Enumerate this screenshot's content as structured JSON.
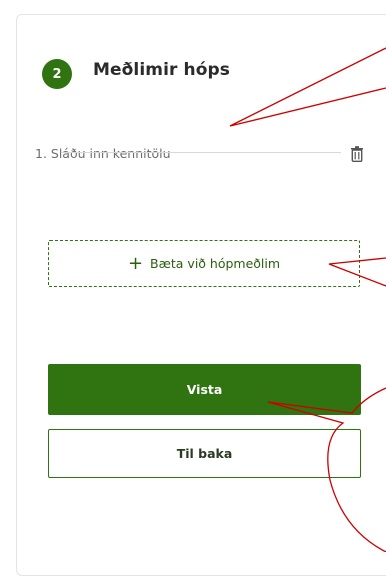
{
  "colors": {
    "accent": "#2f7410",
    "annotation": "#cc0000"
  },
  "section": {
    "step_number": "2",
    "title": "Meðlimir hóps"
  },
  "members": [
    {
      "placeholder": "1. Sláðu inn kennitölu",
      "value": ""
    }
  ],
  "icons": {
    "delete": "trash-icon",
    "add": "plus-icon"
  },
  "buttons": {
    "add_member_label": "Bæta við hópmeðlim",
    "add_member_prefix": "+",
    "save_label": "Vista",
    "back_label": "Til baka"
  }
}
